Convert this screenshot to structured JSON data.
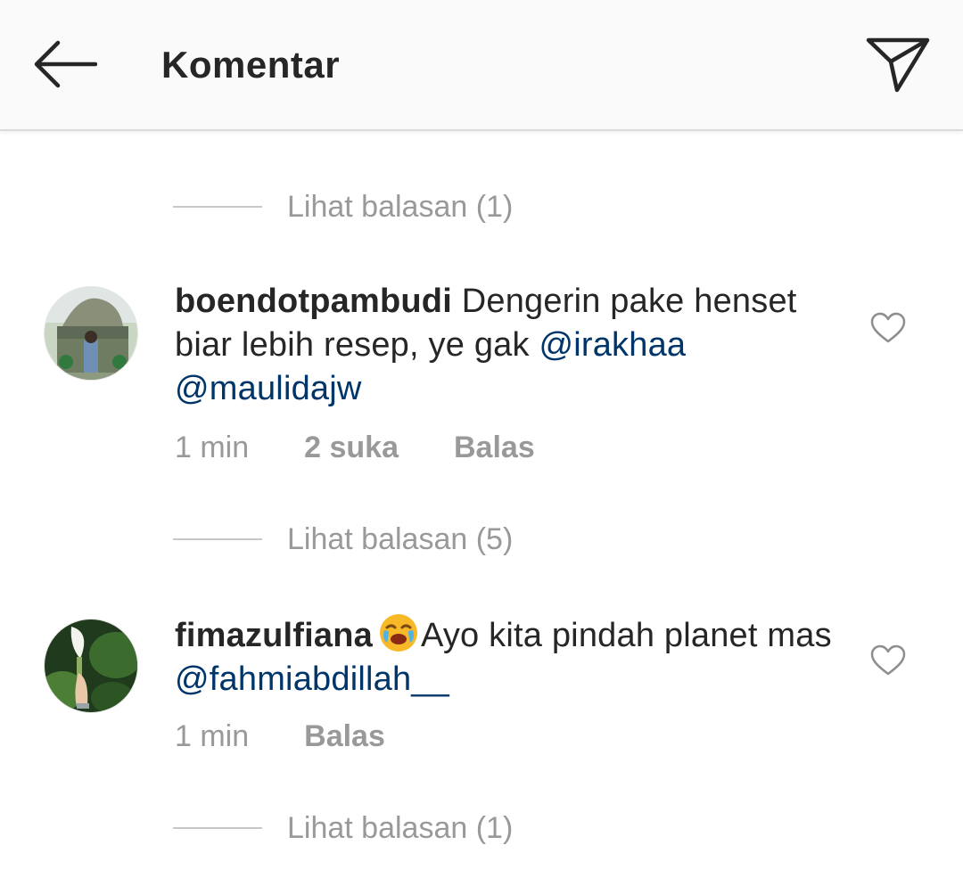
{
  "header": {
    "title": "Komentar",
    "back_icon": "arrow-left-icon",
    "share_icon": "paper-plane-icon"
  },
  "replies_toggles": [
    {
      "label": "Lihat balasan (1)"
    },
    {
      "label": "Lihat balasan (5)"
    },
    {
      "label": "Lihat balasan (1)"
    }
  ],
  "comments": [
    {
      "username": "boendotpambudi",
      "text_before": " Dengerin pake henset biar lebih resep, ye gak ",
      "mention1": "@irakhaa",
      "text_between": " ",
      "mention2": "@maulidajw",
      "time": "1 min",
      "likes": "2 suka",
      "reply": "Balas"
    },
    {
      "username": "fimazulfiana",
      "emoji": "crying-face-emoji",
      "text": "Ayo kita pindah planet mas ",
      "mention": "@fahmiabdillah__",
      "time": "1 min",
      "reply": "Balas"
    }
  ],
  "colors": {
    "mention": "#003569",
    "secondary_text": "#999999",
    "primary_text": "#262626",
    "header_bg": "#fafafa"
  }
}
